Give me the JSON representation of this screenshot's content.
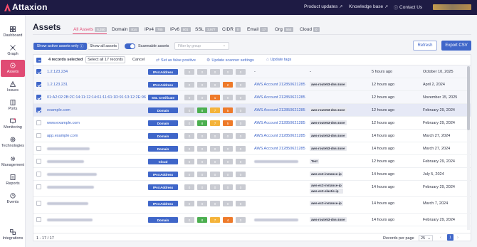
{
  "app": {
    "logo_text": "Attaxion",
    "top_links": [
      {
        "label": "Product updates",
        "icon": "external-link-icon"
      },
      {
        "label": "Knowledge base",
        "icon": "external-link-icon"
      },
      {
        "label": "Contact Us",
        "icon": "help-circle-icon"
      }
    ]
  },
  "sidebar": {
    "items": [
      {
        "label": "Dashboard",
        "icon": "grid-icon"
      },
      {
        "label": "Graph",
        "icon": "graph-icon"
      },
      {
        "label": "Assets",
        "icon": "assets-icon",
        "active": true
      },
      {
        "label": "Issues",
        "icon": "warning-icon"
      },
      {
        "label": "Ports",
        "icon": "ports-icon"
      },
      {
        "label": "Monitoring",
        "icon": "monitoring-icon"
      },
      {
        "label": "Technologies",
        "icon": "technologies-icon"
      },
      {
        "label": "Management",
        "icon": "gear-icon"
      },
      {
        "label": "Reports",
        "icon": "reports-icon"
      },
      {
        "label": "Events",
        "icon": "events-icon"
      },
      {
        "label": "Integrations",
        "icon": "integrations-icon"
      }
    ]
  },
  "page": {
    "title": "Assets",
    "tabs": [
      {
        "label": "All Assets",
        "count": "6,350",
        "active": true
      },
      {
        "label": "Domain",
        "count": "814"
      },
      {
        "label": "IPv4",
        "count": "785"
      },
      {
        "label": "IPv6",
        "count": "801"
      },
      {
        "label": "SSL",
        "count": "3,977"
      },
      {
        "label": "CIDR",
        "count": "0"
      },
      {
        "label": "Email",
        "count": "17"
      },
      {
        "label": "Org",
        "count": "564"
      },
      {
        "label": "Cloud",
        "count": "0"
      }
    ]
  },
  "toolbar": {
    "show_active_label": "Show active assets only",
    "show_all_label": "Show all assets",
    "scannable_label": "Scannable assets",
    "filter_placeholder": "Filter by group",
    "refresh_label": "Refresh",
    "export_label": "Export CSV"
  },
  "actionbar": {
    "selected_text": "4 records selected",
    "select_all_label": "Select all 17 records",
    "cancel_label": "Cancel",
    "false_positive_label": "Set as false positive",
    "scanner_settings_label": "Update scanner settings",
    "update_tags_label": "Update tags"
  },
  "rows": [
    {
      "name": "1.2.123.234",
      "type": "IPv4 Address",
      "pills": [
        "0",
        "0",
        "0",
        "0",
        "0"
      ],
      "pill_colors": [
        "",
        "",
        "",
        "",
        ""
      ],
      "account": "-",
      "tags": [],
      "last_seen": "5 hours ago",
      "date": "October 10, 2025",
      "checked": true
    },
    {
      "name": "1.2.123.231",
      "type": "IPv4 Address",
      "pills": [
        "0",
        "0",
        "0",
        "2",
        "0"
      ],
      "pill_colors": [
        "",
        "",
        "",
        "o",
        ""
      ],
      "account": "AWS Account 212850621285",
      "tags": [
        "aws-route53-dns-zone"
      ],
      "last_seen": "12 hours ago",
      "date": "April 2, 2024",
      "checked": true
    },
    {
      "name": "01:A2:02:2B:2C:14:11:12:14:61:11:61:1D:91:13:12:2E:96",
      "type": "SSL Certificate",
      "pills": [
        "0",
        "0",
        "1",
        "0",
        "0"
      ],
      "pill_colors": [
        "",
        "",
        "o",
        "",
        ""
      ],
      "account": "AWS Account 212850621285",
      "tags": [],
      "last_seen": "12 hours ago",
      "date": "November 15, 2025",
      "checked": true
    },
    {
      "name": "example.com",
      "type": "Domain",
      "pills": [
        "0",
        "8",
        "7",
        "5",
        "0"
      ],
      "pill_colors": [
        "",
        "g",
        "y",
        "o",
        ""
      ],
      "account": "AWS Account 212850621285",
      "tags": [
        "aws-route53-dns-zone"
      ],
      "last_seen": "12 hours ago",
      "date": "February 29, 2024",
      "checked": true
    },
    {
      "name": "www.example.com",
      "type": "Domain",
      "pills": [
        "0",
        "8",
        "7",
        "5",
        "0"
      ],
      "pill_colors": [
        "",
        "g",
        "y",
        "o",
        ""
      ],
      "account": "AWS Account 212850621285",
      "tags": [
        "aws-route53-dns-zone"
      ],
      "last_seen": "12 hours ago",
      "date": "February 29, 2024",
      "checked": false
    },
    {
      "name": "app.example.com",
      "type": "Domain",
      "pills": [
        "0",
        "0",
        "0",
        "0",
        "0"
      ],
      "pill_colors": [
        "",
        "",
        "",
        "",
        ""
      ],
      "account": "AWS Account 212850621285",
      "tags": [
        "aws-route53-dns-zone"
      ],
      "last_seen": "14 hours ago",
      "date": "March 27, 2024",
      "checked": false
    },
    {
      "name": "",
      "type": "Domain",
      "pills": [
        "0",
        "0",
        "0",
        "0",
        "0"
      ],
      "pill_colors": [
        "",
        "",
        "",
        "",
        ""
      ],
      "account": "AWS Account 212850621285",
      "tags": [
        "aws-route53-dns-zone"
      ],
      "last_seen": "14 hours ago",
      "date": "March 27, 2024",
      "checked": false
    },
    {
      "name": "",
      "type": "Cloud",
      "pills": [
        "0",
        "0",
        "0",
        "0",
        "0"
      ],
      "pill_colors": [
        "",
        "",
        "",
        "",
        ""
      ],
      "account": "",
      "tags": [
        "Test"
      ],
      "last_seen": "12 hours ago",
      "date": "February 29, 2024",
      "checked": false
    },
    {
      "name": "",
      "type": "IPv4 Address",
      "pills": [
        "0",
        "0",
        "0",
        "0",
        "0"
      ],
      "pill_colors": [
        "",
        "",
        "",
        "",
        ""
      ],
      "account": "",
      "tags": [
        "aws-ec2-instance-ip"
      ],
      "last_seen": "14 hours ago",
      "date": "July 5, 2024",
      "checked": false
    },
    {
      "name": "",
      "type": "IPv4 Address",
      "pills": [
        "0",
        "0",
        "0",
        "0",
        "0"
      ],
      "pill_colors": [
        "",
        "",
        "",
        "",
        ""
      ],
      "account": "",
      "tags": [
        "aws-ec2-instance-ip",
        "aws-ec2-elastic-ip"
      ],
      "last_seen": "14 hours ago",
      "date": "February 29, 2024",
      "checked": false
    },
    {
      "name": "",
      "type": "IPv4 Address",
      "pills": [
        "0",
        "0",
        "0",
        "0",
        "0"
      ],
      "pill_colors": [
        "",
        "",
        "",
        "",
        ""
      ],
      "account": "",
      "tags": [
        "aws-ec2-instance-ip"
      ],
      "last_seen": "14 hours ago",
      "date": "March 7, 2024",
      "checked": false
    },
    {
      "name": "",
      "type": "Domain",
      "pills": [
        "0",
        "8",
        "7",
        "4",
        "0"
      ],
      "pill_colors": [
        "",
        "g",
        "y",
        "o",
        ""
      ],
      "account": "",
      "tags": [
        "aws-route53-dns-zone"
      ],
      "last_seen": "14 hours ago",
      "date": "February 29, 2024",
      "checked": false
    }
  ],
  "footer": {
    "range": "1 - 17 / 17",
    "rpp_label": "Records per page",
    "rpp_value": "25",
    "current_page": "1"
  },
  "colors": {
    "accent": "#3f66c9",
    "brand": "#e04b74",
    "topbar": "#1e1b44"
  }
}
